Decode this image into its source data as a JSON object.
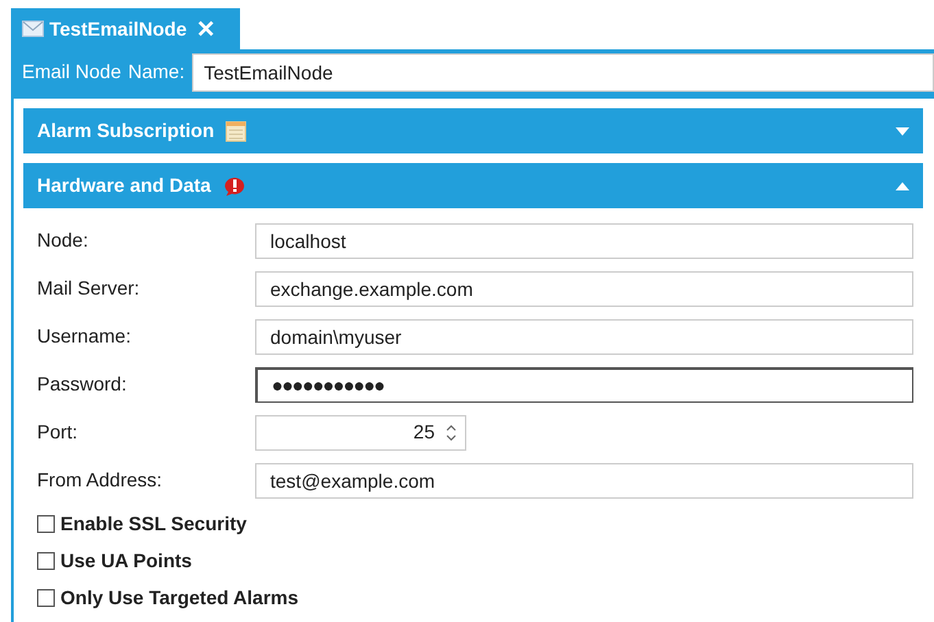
{
  "tab": {
    "title": "TestEmailNode",
    "close": "✕",
    "selected": true
  },
  "name_field": {
    "label_1": "Email Node",
    "label_2": "Name:",
    "value": "TestEmailNode"
  },
  "sections": [
    {
      "title": "Alarm Subscription",
      "kind": "calendar",
      "expanded": false
    },
    {
      "title": "Hardware and Data",
      "kind": "alert",
      "expanded": true
    }
  ],
  "fields": [
    {
      "label": "Node:",
      "value": "localhost",
      "kind": "text",
      "focused": false
    },
    {
      "label": "Mail Server:",
      "value": "exchange.example.com",
      "kind": "text",
      "focused": false
    },
    {
      "label": "Username:",
      "value": "domain\\myuser",
      "kind": "text",
      "focused": false
    },
    {
      "label": "Password:",
      "value": "●●●●●●●●●●●",
      "kind": "password",
      "focused": true
    },
    {
      "label": "Port:",
      "value": "25",
      "kind": "number",
      "focused": false
    },
    {
      "label": "From Address:",
      "value": "test@example.com",
      "kind": "text",
      "focused": false
    }
  ],
  "checkboxes": [
    {
      "label": "Enable SSL Security",
      "checked": false
    },
    {
      "label": "Use UA Points",
      "checked": false
    },
    {
      "label": "Only Use Targeted Alarms",
      "checked": false
    }
  ]
}
